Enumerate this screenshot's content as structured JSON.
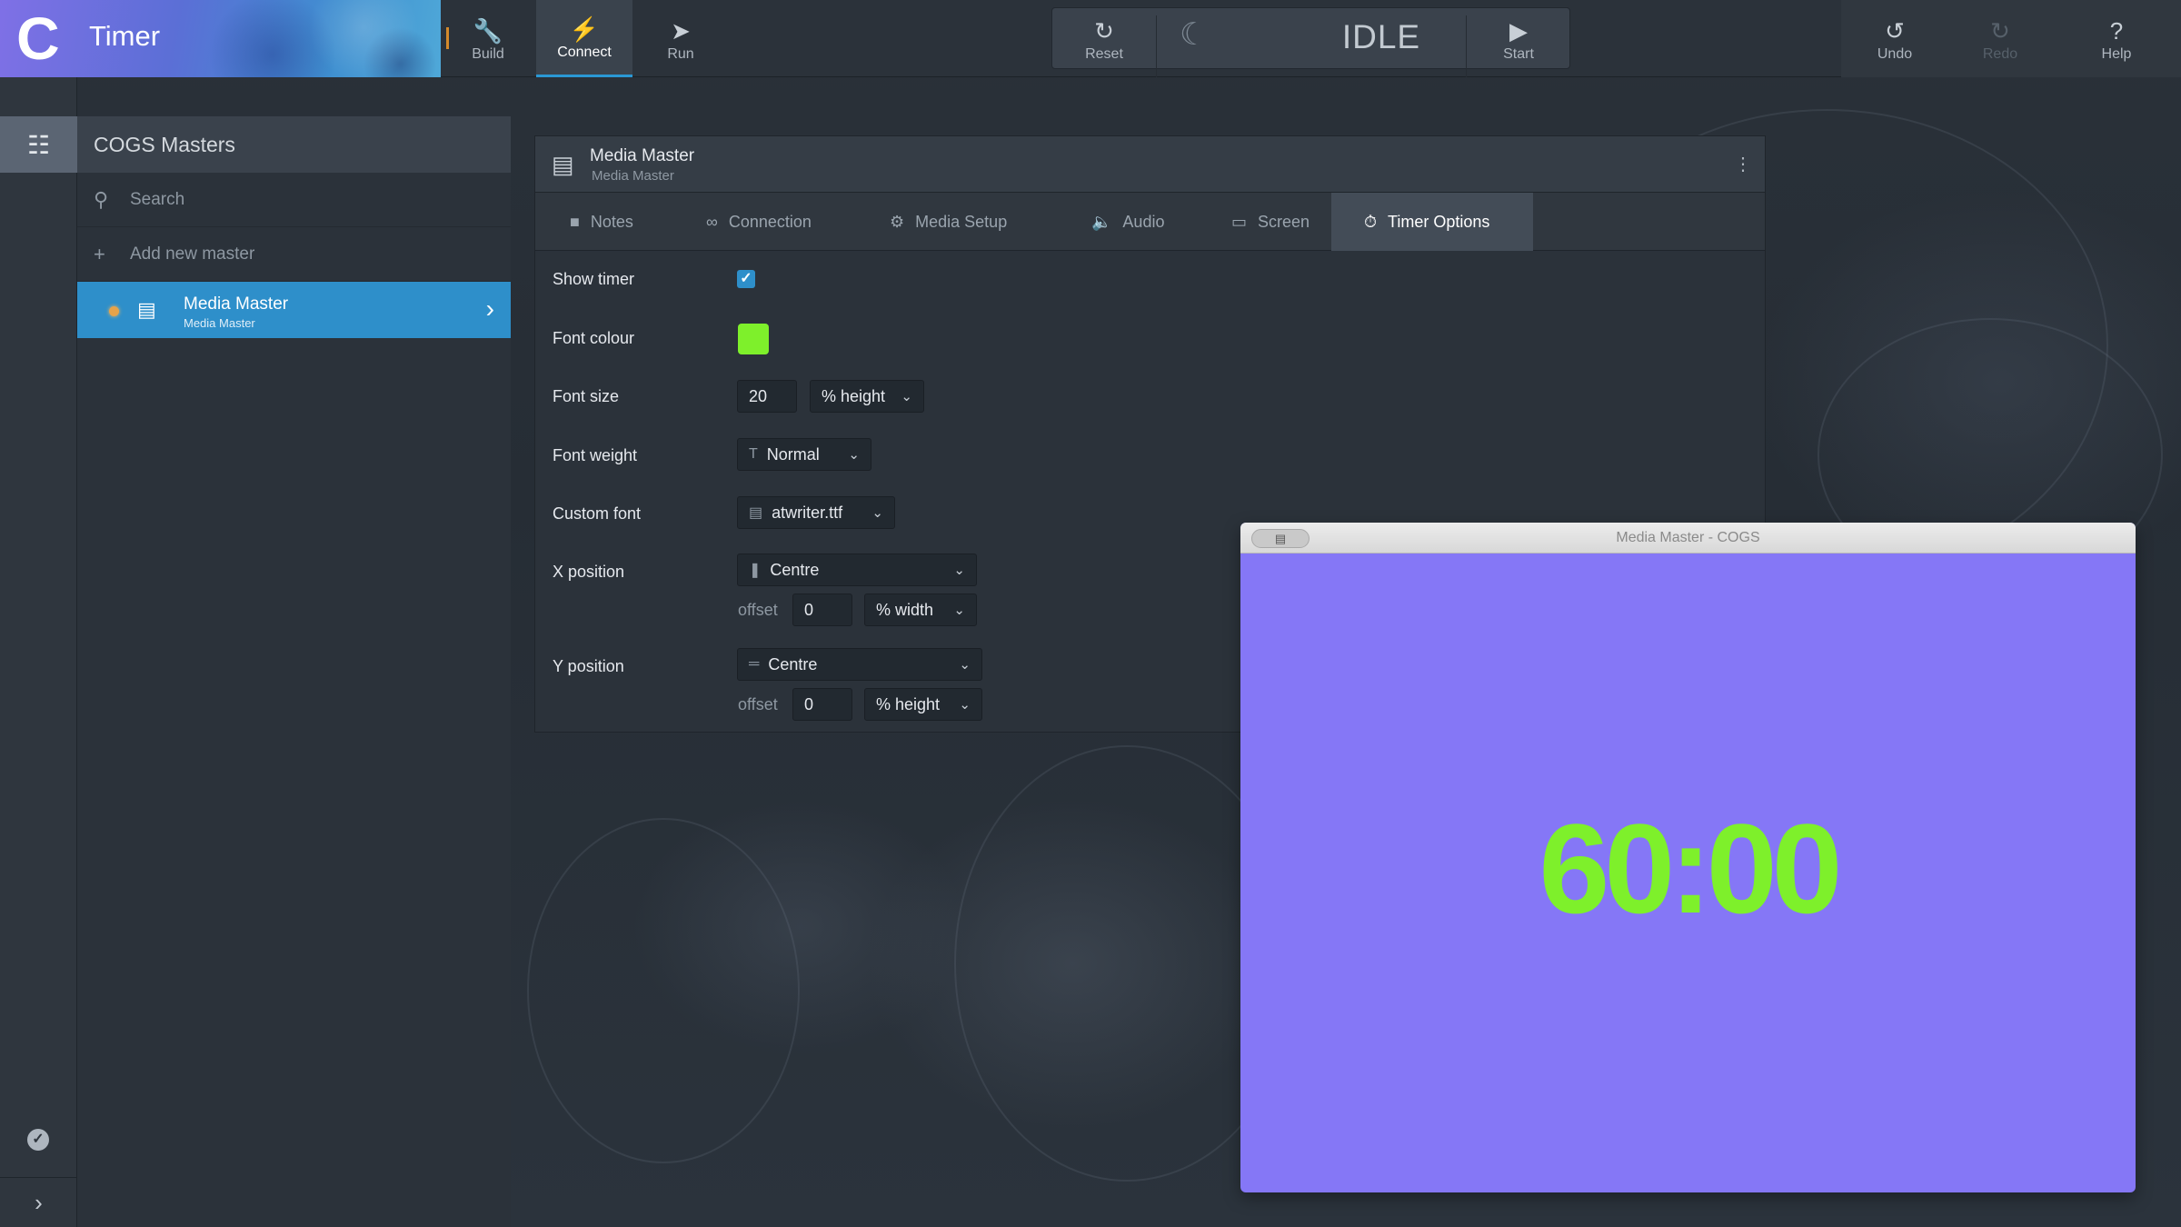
{
  "app": {
    "title": "Timer",
    "logo_glyph": "C"
  },
  "toolbar": {
    "build": {
      "label": "Build",
      "icon": "wrench-icon"
    },
    "connect": {
      "label": "Connect",
      "icon": "plug-icon"
    },
    "run": {
      "label": "Run",
      "icon": "rocket-icon"
    },
    "reset": {
      "label": "Reset",
      "icon": "refresh-icon"
    },
    "state": "IDLE",
    "start": {
      "label": "Start",
      "icon": "play-icon"
    },
    "undo": {
      "label": "Undo",
      "icon": "undo-icon"
    },
    "redo": {
      "label": "Redo",
      "icon": "redo-icon"
    },
    "help": {
      "label": "Help",
      "icon": "question-icon"
    }
  },
  "masters": {
    "header": "COGS Masters",
    "search_placeholder": "Search",
    "add_label": "Add new master",
    "items": [
      {
        "name": "Media Master",
        "sub": "Media Master",
        "status_color": "#e6a34a"
      }
    ]
  },
  "panel": {
    "title": "Media Master",
    "subtitle": "Media Master",
    "tabs": [
      {
        "label": "Notes",
        "icon": "notes-icon"
      },
      {
        "label": "Connection",
        "icon": "connection-icon"
      },
      {
        "label": "Media Setup",
        "icon": "gear-icon"
      },
      {
        "label": "Audio",
        "icon": "speaker-icon"
      },
      {
        "label": "Screen",
        "icon": "monitor-icon"
      },
      {
        "label": "Timer Options",
        "icon": "stopwatch-icon",
        "active": true
      }
    ],
    "form": {
      "show_timer": {
        "label": "Show timer",
        "checked": true
      },
      "font_colour": {
        "label": "Font colour",
        "value": "#7ef02b"
      },
      "font_size": {
        "label": "Font size",
        "value": "20",
        "unit": "% height"
      },
      "font_weight": {
        "label": "Font weight",
        "value": "Normal"
      },
      "custom_font": {
        "label": "Custom font",
        "value": "atwriter.ttf"
      },
      "x_position": {
        "label": "X position",
        "value": "Centre",
        "offset_label": "offset",
        "offset": "0",
        "offset_unit": "% width"
      },
      "y_position": {
        "label": "Y position",
        "value": "Centre",
        "offset_label": "offset",
        "offset": "0",
        "offset_unit": "% height"
      }
    }
  },
  "preview": {
    "window_title": "Media Master - COGS",
    "timer": "60:00",
    "background_color": "#8577f6",
    "timer_color": "#7ef02b"
  },
  "colors": {
    "accent": "#2e8fca",
    "brand_start": "#7f70e6",
    "brand_end": "#4fa8d8"
  }
}
